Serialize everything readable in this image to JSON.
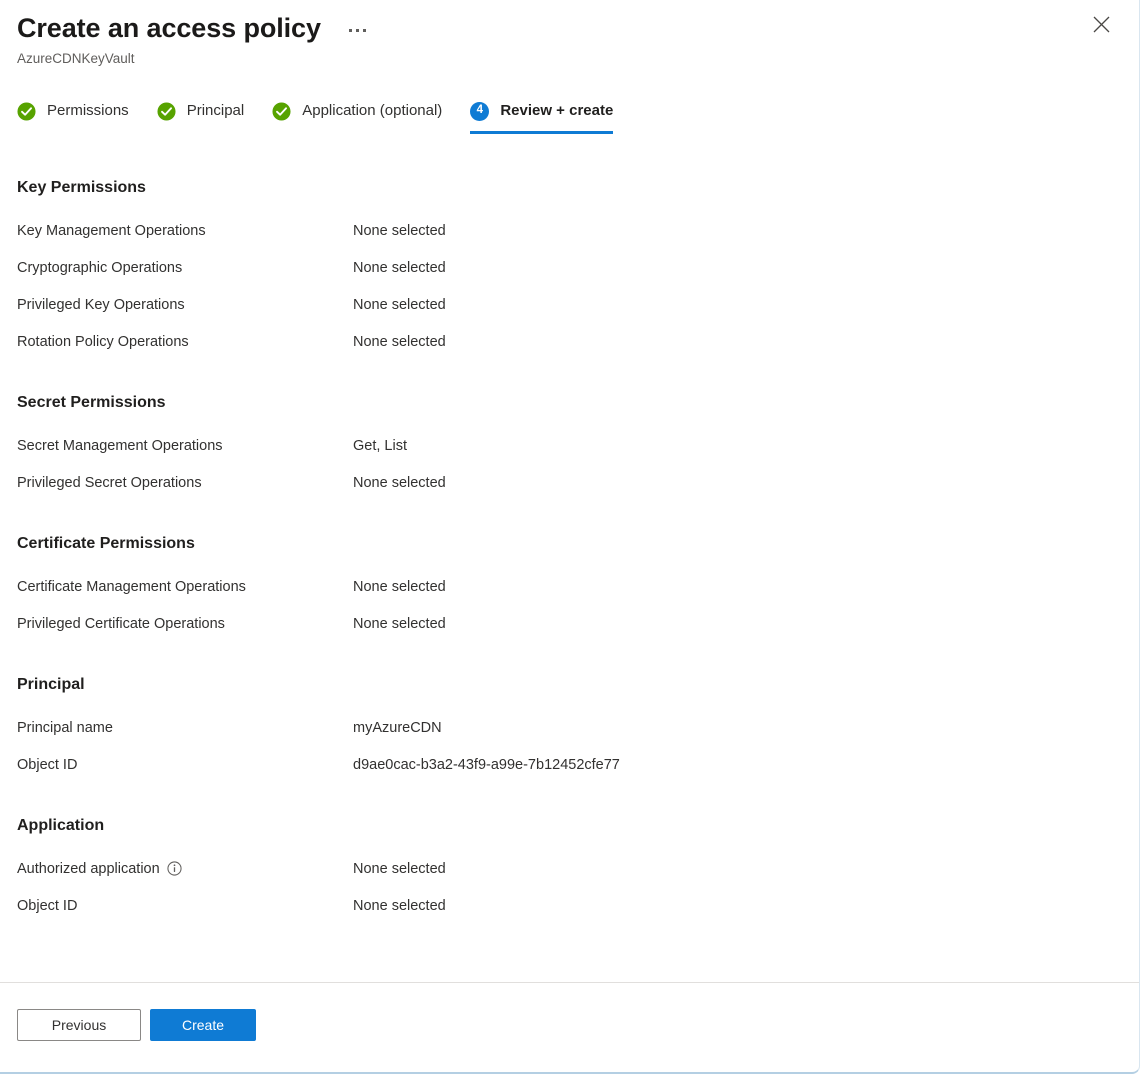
{
  "header": {
    "title": "Create an access policy",
    "subtitle": "AzureCDNKeyVault",
    "more_menu_label": "···",
    "close_label": "Close",
    "more_icon": "ellipsis-icon",
    "close_icon": "close-icon"
  },
  "tabs": [
    {
      "label": "Permissions",
      "state": "complete",
      "icon": "check-circle-icon"
    },
    {
      "label": "Principal",
      "state": "complete",
      "icon": "check-circle-icon"
    },
    {
      "label": "Application (optional)",
      "state": "complete",
      "icon": "check-circle-icon"
    },
    {
      "label": "Review + create",
      "state": "active",
      "step": "4",
      "icon": "step-number-badge"
    }
  ],
  "sections": [
    {
      "heading": "Key Permissions",
      "rows": [
        {
          "key": "Key Management Operations",
          "value": "None selected"
        },
        {
          "key": "Cryptographic Operations",
          "value": "None selected"
        },
        {
          "key": "Privileged Key Operations",
          "value": "None selected"
        },
        {
          "key": "Rotation Policy Operations",
          "value": "None selected"
        }
      ]
    },
    {
      "heading": "Secret Permissions",
      "rows": [
        {
          "key": "Secret Management Operations",
          "value": "Get, List"
        },
        {
          "key": "Privileged Secret Operations",
          "value": "None selected"
        }
      ]
    },
    {
      "heading": "Certificate Permissions",
      "rows": [
        {
          "key": "Certificate Management Operations",
          "value": "None selected"
        },
        {
          "key": "Privileged Certificate Operations",
          "value": "None selected"
        }
      ]
    },
    {
      "heading": "Principal",
      "rows": [
        {
          "key": "Principal name",
          "value": "myAzureCDN"
        },
        {
          "key": "Object ID",
          "value": "d9ae0cac-b3a2-43f9-a99e-7b12452cfe77"
        }
      ]
    },
    {
      "heading": "Application",
      "rows": [
        {
          "key": "Authorized application",
          "value": "None selected",
          "info_icon": "info-icon"
        },
        {
          "key": "Object ID",
          "value": "None selected"
        }
      ]
    }
  ],
  "footer": {
    "previous_label": "Previous",
    "create_label": "Create"
  },
  "colors": {
    "accent_blue": "#0f7bd4",
    "success_green": "#57a300",
    "text_primary": "#323130",
    "text_secondary": "#605e5c",
    "divider": "#e1dfdd"
  }
}
